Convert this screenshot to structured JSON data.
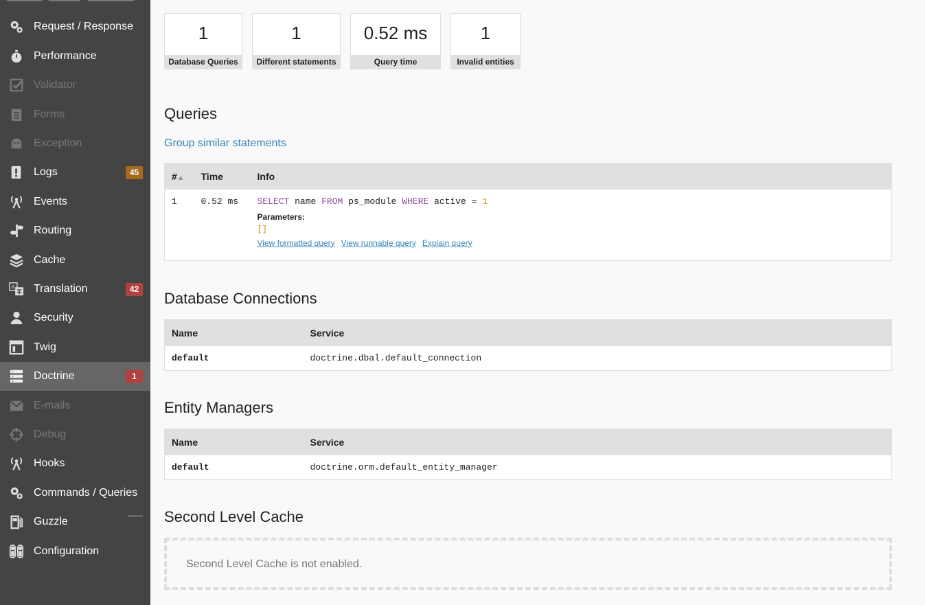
{
  "sidebar": {
    "items": [
      {
        "label": "Request / Response",
        "icon": "gears-icon",
        "state": "enabled"
      },
      {
        "label": "Performance",
        "icon": "stopwatch-icon",
        "state": "enabled"
      },
      {
        "label": "Validator",
        "icon": "checkbox-icon",
        "state": "disabled"
      },
      {
        "label": "Forms",
        "icon": "clipboard-icon",
        "state": "disabled"
      },
      {
        "label": "Exception",
        "icon": "ghost-icon",
        "state": "disabled"
      },
      {
        "label": "Logs",
        "icon": "exclamation-icon",
        "state": "enabled",
        "badge": "45",
        "badge_type": "warn"
      },
      {
        "label": "Events",
        "icon": "antenna-icon",
        "state": "enabled"
      },
      {
        "label": "Routing",
        "icon": "signpost-icon",
        "state": "enabled"
      },
      {
        "label": "Cache",
        "icon": "layers-icon",
        "state": "enabled"
      },
      {
        "label": "Translation",
        "icon": "translate-icon",
        "state": "enabled",
        "badge": "42",
        "badge_type": "error"
      },
      {
        "label": "Security",
        "icon": "person-icon",
        "state": "enabled"
      },
      {
        "label": "Twig",
        "icon": "template-icon",
        "state": "enabled"
      },
      {
        "label": "Doctrine",
        "icon": "database-icon",
        "state": "active",
        "badge": "1",
        "badge_type": "error"
      },
      {
        "label": "E-mails",
        "icon": "envelope-icon",
        "state": "disabled"
      },
      {
        "label": "Debug",
        "icon": "crosshair-icon",
        "state": "disabled"
      },
      {
        "label": "Hooks",
        "icon": "antenna-icon",
        "state": "enabled"
      },
      {
        "label": "Commands / Queries",
        "icon": "gears-icon",
        "state": "enabled"
      },
      {
        "label": "Guzzle",
        "icon": "fuel-pump-icon",
        "state": "enabled",
        "badge": "",
        "badge_type": "dash"
      },
      {
        "label": "Configuration",
        "icon": "toggles-icon",
        "state": "enabled"
      }
    ]
  },
  "metrics": [
    {
      "value": "1",
      "label": "Database Queries"
    },
    {
      "value": "1",
      "label": "Different statements"
    },
    {
      "value": "0.52 ms",
      "label": "Query time"
    },
    {
      "value": "1",
      "label": "Invalid entities"
    }
  ],
  "queries": {
    "title": "Queries",
    "group_link": "Group similar statements",
    "headers": {
      "num": "#",
      "sort_indicator": "▲",
      "time": "Time",
      "info": "Info"
    },
    "rows": [
      {
        "num": "1",
        "time": "0.52 ms",
        "sql": {
          "select": "SELECT",
          "cols": " name ",
          "from": "FROM",
          "table": " ps_module ",
          "where": "WHERE",
          "cond": " active = ",
          "value": "1"
        },
        "params_label": "Parameters:",
        "params_value": "[]",
        "links": [
          "View formatted query",
          "View runnable query",
          "Explain query"
        ]
      }
    ]
  },
  "connections": {
    "title": "Database Connections",
    "headers": {
      "name": "Name",
      "service": "Service"
    },
    "rows": [
      {
        "name": "default",
        "service": "doctrine.dbal.default_connection"
      }
    ]
  },
  "entity_managers": {
    "title": "Entity Managers",
    "headers": {
      "name": "Name",
      "service": "Service"
    },
    "rows": [
      {
        "name": "default",
        "service": "doctrine.orm.default_entity_manager"
      }
    ]
  },
  "second_level_cache": {
    "title": "Second Level Cache",
    "message": "Second Level Cache is not enabled."
  }
}
